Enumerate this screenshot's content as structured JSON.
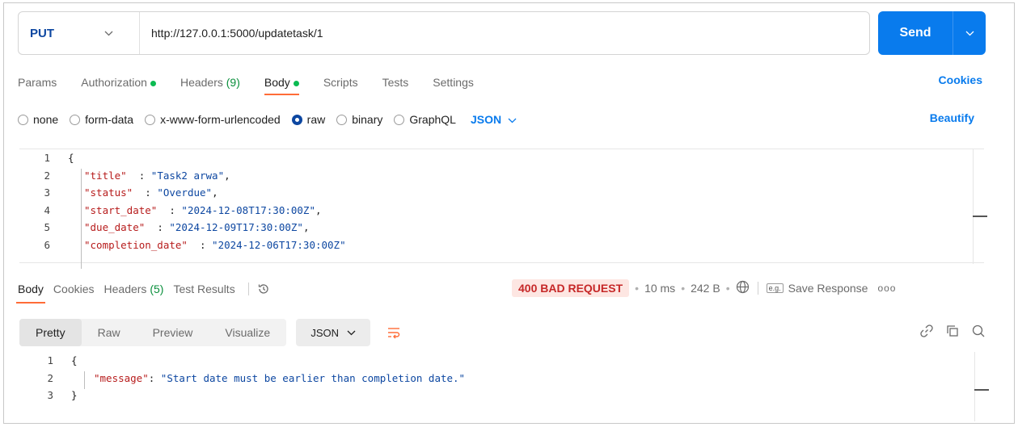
{
  "request": {
    "method": "PUT",
    "url": "http://127.0.0.1:5000/updatetask/1",
    "send_label": "Send"
  },
  "request_tabs": [
    {
      "label": "Params",
      "indicator": false
    },
    {
      "label": "Authorization",
      "indicator": true
    },
    {
      "label": "Headers",
      "count": "(9)",
      "indicator": false
    },
    {
      "label": "Body",
      "indicator": true,
      "active": true
    },
    {
      "label": "Scripts"
    },
    {
      "label": "Tests"
    },
    {
      "label": "Settings"
    }
  ],
  "cookies_label": "Cookies",
  "body_types": {
    "none": "none",
    "form_data": "form-data",
    "urlencoded": "x-www-form-urlencoded",
    "raw": "raw",
    "binary": "binary",
    "graphql": "GraphQL",
    "selected": "raw",
    "language": "JSON"
  },
  "beautify_label": "Beautify",
  "request_body": [
    {
      "n": "1",
      "open": "{"
    },
    {
      "n": "2",
      "key": "\"title\"",
      "sep": "  : ",
      "val": "\"Task2 arwa\"",
      "end": ","
    },
    {
      "n": "3",
      "key": "\"status\"",
      "sep": "  : ",
      "val": "\"Overdue\"",
      "end": ","
    },
    {
      "n": "4",
      "key": "\"start_date\"",
      "sep": "  : ",
      "val": "\"2024-12-08T17:30:00Z\"",
      "end": ","
    },
    {
      "n": "5",
      "key": "\"due_date\"",
      "sep": "  : ",
      "val": "\"2024-12-09T17:30:00Z\"",
      "end": ","
    },
    {
      "n": "6",
      "key": "\"completion_date\"",
      "sep": "  : ",
      "val": "\"2024-12-06T17:30:00Z\"",
      "end": ""
    }
  ],
  "response_tabs": {
    "body": "Body",
    "cookies": "Cookies",
    "headers": "Headers",
    "headers_count": "(5)",
    "test_results": "Test Results"
  },
  "response_status": {
    "code": "400 BAD REQUEST",
    "time": "10 ms",
    "size": "242 B",
    "save": "Save Response",
    "eg": "e.g."
  },
  "response_formats": [
    "Pretty",
    "Raw",
    "Preview",
    "Visualize"
  ],
  "response_language": "JSON",
  "response_body": [
    {
      "n": "1",
      "open": "{"
    },
    {
      "n": "2",
      "key": "\"message\"",
      "sep": ": ",
      "val": "\"Start date must be earlier than completion date.\"",
      "end": ""
    },
    {
      "n": "3",
      "open": "}"
    }
  ],
  "colors": {
    "accent": "#097bed",
    "method": "#0d47a1",
    "active_tab": "#ff6c37",
    "status_error": "#c62828",
    "indicator": "#0cbb52"
  }
}
